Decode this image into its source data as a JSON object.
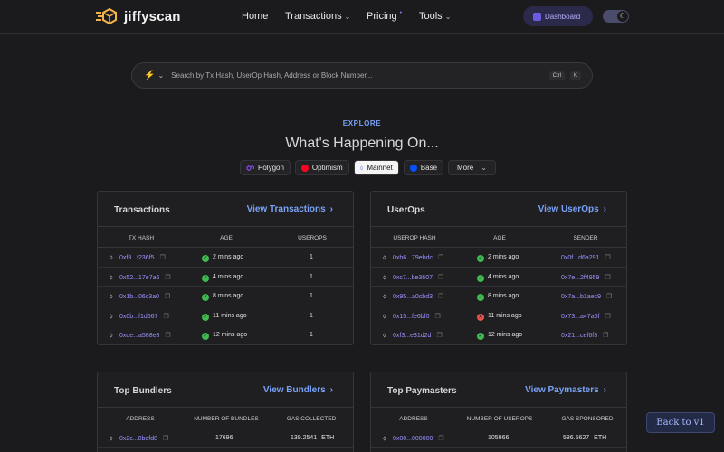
{
  "brand": {
    "name": "jiffyscan"
  },
  "nav": {
    "home": "Home",
    "transactions": "Transactions",
    "pricing": "Pricing",
    "pricing_badge": "•",
    "tools": "Tools"
  },
  "dashboard": {
    "label": "Dashboard"
  },
  "search": {
    "placeholder": "Search by Tx Hash, UserOp Hash, Address or Block Number...",
    "key1": "Ctrl",
    "key2": "K"
  },
  "explore": {
    "eyebrow": "EXPLORE",
    "headline": "What's Happening On..."
  },
  "chains": [
    {
      "label": "Polygon",
      "color": "#8247e5"
    },
    {
      "label": "Optimism",
      "color": "#ff0420"
    },
    {
      "label": "Mainnet",
      "color": "#627eea"
    },
    {
      "label": "Base",
      "color": "#0052ff"
    },
    {
      "label": "More"
    }
  ],
  "transactions": {
    "title": "Transactions",
    "link": "View Transactions",
    "headers": [
      "TX HASH",
      "AGE",
      "USEROPS"
    ],
    "rows": [
      {
        "hash": "0xf3...f236f5",
        "age": "2 mins ago",
        "count": "1"
      },
      {
        "hash": "0x52...17e7a6",
        "age": "4 mins ago",
        "count": "1"
      },
      {
        "hash": "0x1b...06c3a0",
        "age": "8 mins ago",
        "count": "1"
      },
      {
        "hash": "0x0b...f1d667",
        "age": "11 mins ago",
        "count": "1"
      },
      {
        "hash": "0xde...a588e8",
        "age": "12 mins ago",
        "count": "1"
      }
    ]
  },
  "userops": {
    "title": "UserOps",
    "link": "View UserOps",
    "headers": [
      "USEROP HASH",
      "AGE",
      "SENDER"
    ],
    "rows": [
      {
        "hash": "0xb6...79ebdc",
        "age": "2 mins ago",
        "sender": "0x0f...d6a291",
        "status": "success"
      },
      {
        "hash": "0xc7...be3607",
        "age": "4 mins ago",
        "sender": "0x7e...2f4959",
        "status": "success"
      },
      {
        "hash": "0x95...a0cbd3",
        "age": "8 mins ago",
        "sender": "0x7a...b1aec9",
        "status": "success"
      },
      {
        "hash": "0x15...fe6bf0",
        "age": "11 mins ago",
        "sender": "0x73...a47a5f",
        "status": "failed"
      },
      {
        "hash": "0xf3...e31d2d",
        "age": "12 mins ago",
        "sender": "0x21...cef6f3",
        "status": "success"
      }
    ]
  },
  "bundlers": {
    "title": "Top Bundlers",
    "link": "View Bundlers",
    "headers": [
      "ADDRESS",
      "NUMBER OF BUNDLES",
      "GAS COLLECTED"
    ],
    "rows": [
      {
        "address": "0x2c...0bdfd8",
        "count": "17696",
        "gas": "139.2541",
        "unit": "ETH"
      }
    ]
  },
  "paymasters": {
    "title": "Top Paymasters",
    "link": "View Paymasters",
    "headers": [
      "ADDRESS",
      "NUMBER OF USEROPS",
      "GAS SPONSORED"
    ],
    "rows": [
      {
        "address": "0x00...000000",
        "count": "105966",
        "gas": "586.5627",
        "unit": "ETH"
      }
    ]
  },
  "back": {
    "label": "Back to v1"
  }
}
